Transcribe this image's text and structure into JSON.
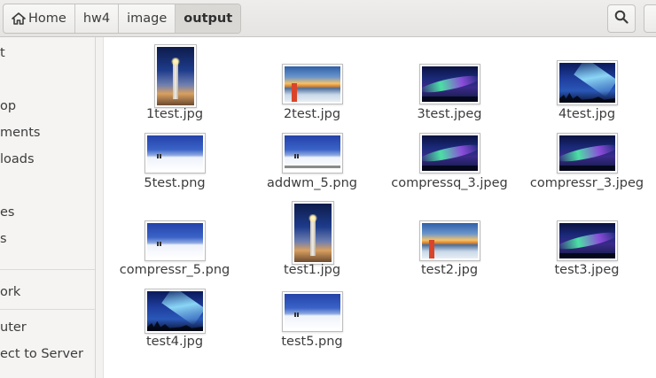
{
  "breadcrumbs": [
    {
      "label": "Home",
      "icon": "home-icon"
    },
    {
      "label": "hw4"
    },
    {
      "label": "image"
    },
    {
      "label": "output",
      "active": true
    }
  ],
  "header": {
    "search_icon": "search-icon"
  },
  "sidebar": {
    "items": [
      {
        "label": "t"
      },
      {
        "label": "op"
      },
      {
        "label": "ments"
      },
      {
        "label": "loads"
      },
      {
        "label": "es"
      },
      {
        "label": "s"
      },
      {
        "label": "ork"
      },
      {
        "label": "uter"
      },
      {
        "label": "ect to Server"
      }
    ]
  },
  "files": [
    {
      "name": "1test.jpg",
      "image": "lighthouse"
    },
    {
      "name": "2test.jpg",
      "image": "sunset"
    },
    {
      "name": "3test.jpeg",
      "image": "aurora"
    },
    {
      "name": "4test.jpg",
      "image": "aurora2"
    },
    {
      "name": "5test.png",
      "image": "snow"
    },
    {
      "name": "addwm_5.png",
      "image": "snow-watermark"
    },
    {
      "name": "compressq_3.jpeg",
      "image": "aurora"
    },
    {
      "name": "compressr_3.jpeg",
      "image": "aurora"
    },
    {
      "name": "compressr_5.png",
      "image": "snow"
    },
    {
      "name": "test1.jpg",
      "image": "lighthouse"
    },
    {
      "name": "test2.jpg",
      "image": "sunset"
    },
    {
      "name": "test3.jpeg",
      "image": "aurora"
    },
    {
      "name": "test4.jpg",
      "image": "aurora2"
    },
    {
      "name": "test5.png",
      "image": "snow"
    }
  ]
}
